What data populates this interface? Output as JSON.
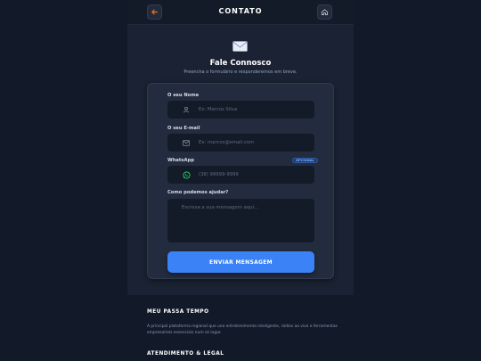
{
  "header": {
    "title": "CONTATO",
    "back_icon": "arrow-left-icon",
    "home_icon": "home-icon",
    "accent": "#f97316"
  },
  "hero": {
    "icon": "envelope-icon",
    "title": "Fale Connosco",
    "subtitle": "Preencha o formulário e responderemos em breve."
  },
  "form": {
    "name": {
      "label": "O seu Nome",
      "placeholder": "Ex: Marcos Silva",
      "icon": "user-icon"
    },
    "email": {
      "label": "O seu E-mail",
      "placeholder": "Ex: marcos@email.com",
      "icon": "mail-icon"
    },
    "whatsapp": {
      "label": "WhatsApp",
      "badge": "OPCIONAL",
      "placeholder": "(38) 99999-9999",
      "icon": "whatsapp-icon"
    },
    "message": {
      "label": "Como podemos ajudar?",
      "placeholder": "Escreva a sua mensagem aqui..."
    },
    "submit_label": "ENVIAR MENSAGEM"
  },
  "footer": {
    "section1_title": "MEU PASSA TEMPO",
    "section1_text": "A principal plataforma regional que une entretenimento inteligente, rádios ao vivo e ferramentas empresariais essenciais num só lugar.",
    "section2_title": "ATENDIMENTO & LEGAL"
  },
  "colors": {
    "background": "#121a29",
    "panel": "#1a2233",
    "card": "#222c3e",
    "primary": "#3b82f6",
    "whatsapp": "#25d366"
  }
}
